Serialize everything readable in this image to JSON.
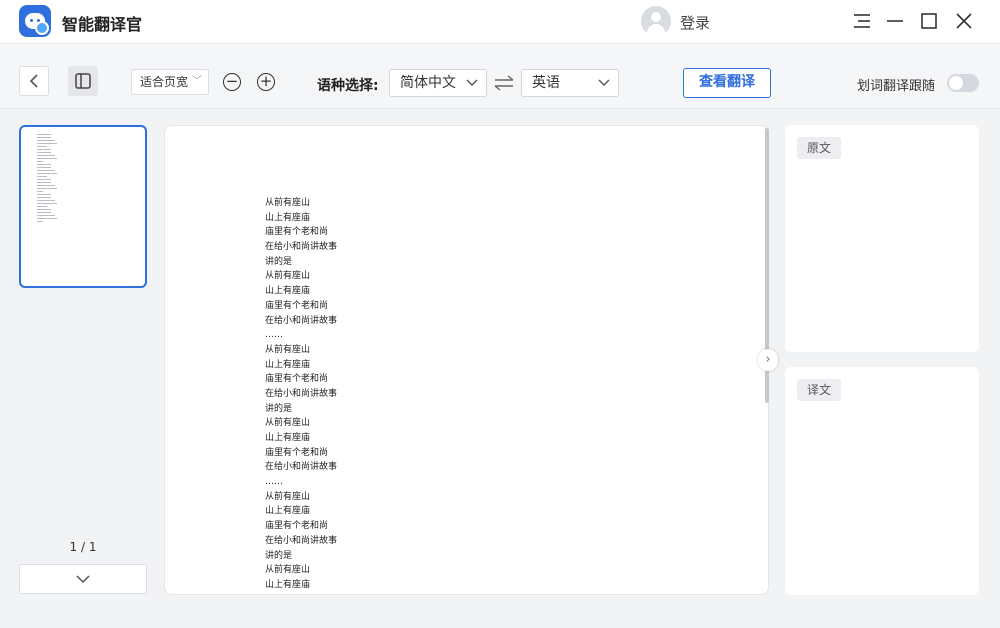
{
  "app": {
    "title": "智能翻译官",
    "login_label": "登录",
    "accent_color": "#2f6fde",
    "logo_icon": "chat-bot-logo"
  },
  "window_controls": {
    "menu_icon": "menu-icon",
    "minimize_icon": "minimize-icon",
    "maximize_icon": "maximize-icon",
    "close_icon": "close-icon"
  },
  "toolbar": {
    "back_icon": "chevron-left-icon",
    "sidebar_icon": "sidebar-toggle-icon",
    "fit_mode": "适合页宽",
    "zoom_out_icon": "zoom-out-icon",
    "zoom_in_icon": "zoom-in-icon",
    "language_label": "语种选择:",
    "source_language": "简体中文",
    "target_language": "英语",
    "swap_icon": "swap-arrows-icon",
    "view_translation_label": "查看翻译",
    "follow_label": "划词翻译跟随",
    "follow_enabled": false
  },
  "sidebar": {
    "page_indicator": "1 / 1",
    "next_icon": "chevron-down-icon"
  },
  "document": {
    "lines": [
      "从前有座山",
      "山上有座庙",
      "庙里有个老和尚",
      "在给小和尚讲故事",
      "讲的是",
      "从前有座山",
      "山上有座庙",
      "庙里有个老和尚",
      "在给小和尚讲故事",
      "……",
      "从前有座山",
      "山上有座庙",
      "庙里有个老和尚",
      "在给小和尚讲故事",
      "讲的是",
      "从前有座山",
      "山上有座庙",
      "庙里有个老和尚",
      "在给小和尚讲故事",
      "……",
      "从前有座山",
      "山上有座庙",
      "庙里有个老和尚",
      "在给小和尚讲故事",
      "讲的是",
      "从前有座山",
      "山上有座庙"
    ]
  },
  "panels": {
    "source_label": "原文",
    "translation_label": "译文"
  }
}
